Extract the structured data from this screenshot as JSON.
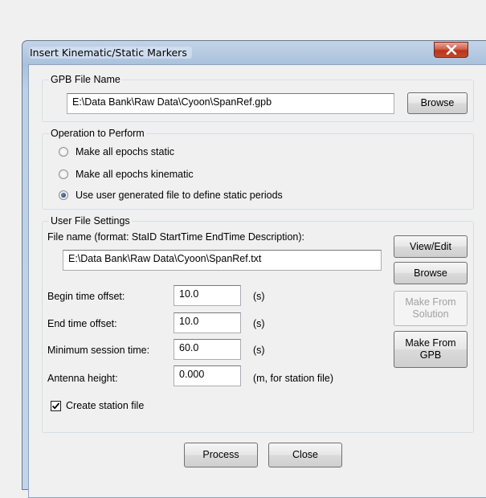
{
  "window": {
    "title": "Insert Kinematic/Static Markers"
  },
  "gpb": {
    "legend": "GPB File Name",
    "path": "E:\\Data Bank\\Raw Data\\Cyoon\\SpanRef.gpb",
    "browse_label": "Browse"
  },
  "operation": {
    "legend": "Operation to Perform",
    "options": [
      {
        "label": "Make all epochs static",
        "checked": false
      },
      {
        "label": "Make all epochs kinematic",
        "checked": false
      },
      {
        "label": "Use user generated file to define static periods",
        "checked": true
      }
    ]
  },
  "user_file": {
    "legend": "User File Settings",
    "filename_label": "File name (format: StaID StartTime EndTime Description):",
    "filename_value": "E:\\Data Bank\\Raw Data\\Cyoon\\SpanRef.txt",
    "view_edit_label": "View/Edit",
    "browse_label": "Browse",
    "make_from_solution_label": "Make From Solution",
    "make_from_gpb_label": "Make From GPB",
    "begin_label": "Begin time offset:",
    "begin_value": "10.0",
    "begin_unit": "(s)",
    "end_label": "End time offset:",
    "end_value": "10.0",
    "end_unit": "(s)",
    "min_label": "Minimum session time:",
    "min_value": "60.0",
    "min_unit": "(s)",
    "antenna_label": "Antenna height:",
    "antenna_value": "0.000",
    "antenna_unit": "(m, for station file)",
    "create_station_label": "Create station file",
    "create_station_checked": true
  },
  "footer": {
    "process_label": "Process",
    "close_label": "Close"
  }
}
